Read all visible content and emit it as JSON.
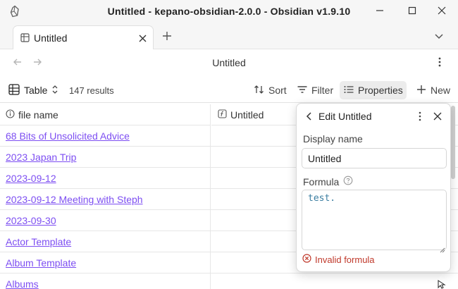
{
  "window": {
    "title": "Untitled - kepano-obsidian-2.0.0 - Obsidian v1.9.10",
    "logo_icon": "obsidian-logo-icon"
  },
  "tabs": [
    {
      "label": "Untitled",
      "icon": "table-icon",
      "active": true
    }
  ],
  "nav": {
    "title": "Untitled"
  },
  "toolbar": {
    "view_label": "Table",
    "results": "147 results",
    "sort_label": "Sort",
    "filter_label": "Filter",
    "properties_label": "Properties",
    "new_label": "New"
  },
  "table": {
    "columns": [
      {
        "label": "file name",
        "icon": "info-icon"
      },
      {
        "label": "Untitled",
        "icon": "formula-icon"
      }
    ],
    "rows": [
      "68 Bits of Unsolicited Advice",
      "2023 Japan Trip",
      "2023-09-12",
      "2023-09-12 Meeting with Steph",
      "2023-09-30",
      "Actor Template",
      "Album Template",
      "Albums"
    ]
  },
  "popover": {
    "title": "Edit Untitled",
    "display_name_label": "Display name",
    "display_name_value": "Untitled",
    "formula_label": "Formula",
    "formula_value": "test.",
    "error_text": "Invalid formula"
  },
  "colors": {
    "link": "#7d4ef2",
    "error": "#c0392b",
    "formula_text": "#3b7ea1",
    "chrome_bg": "#f6f6f6"
  }
}
